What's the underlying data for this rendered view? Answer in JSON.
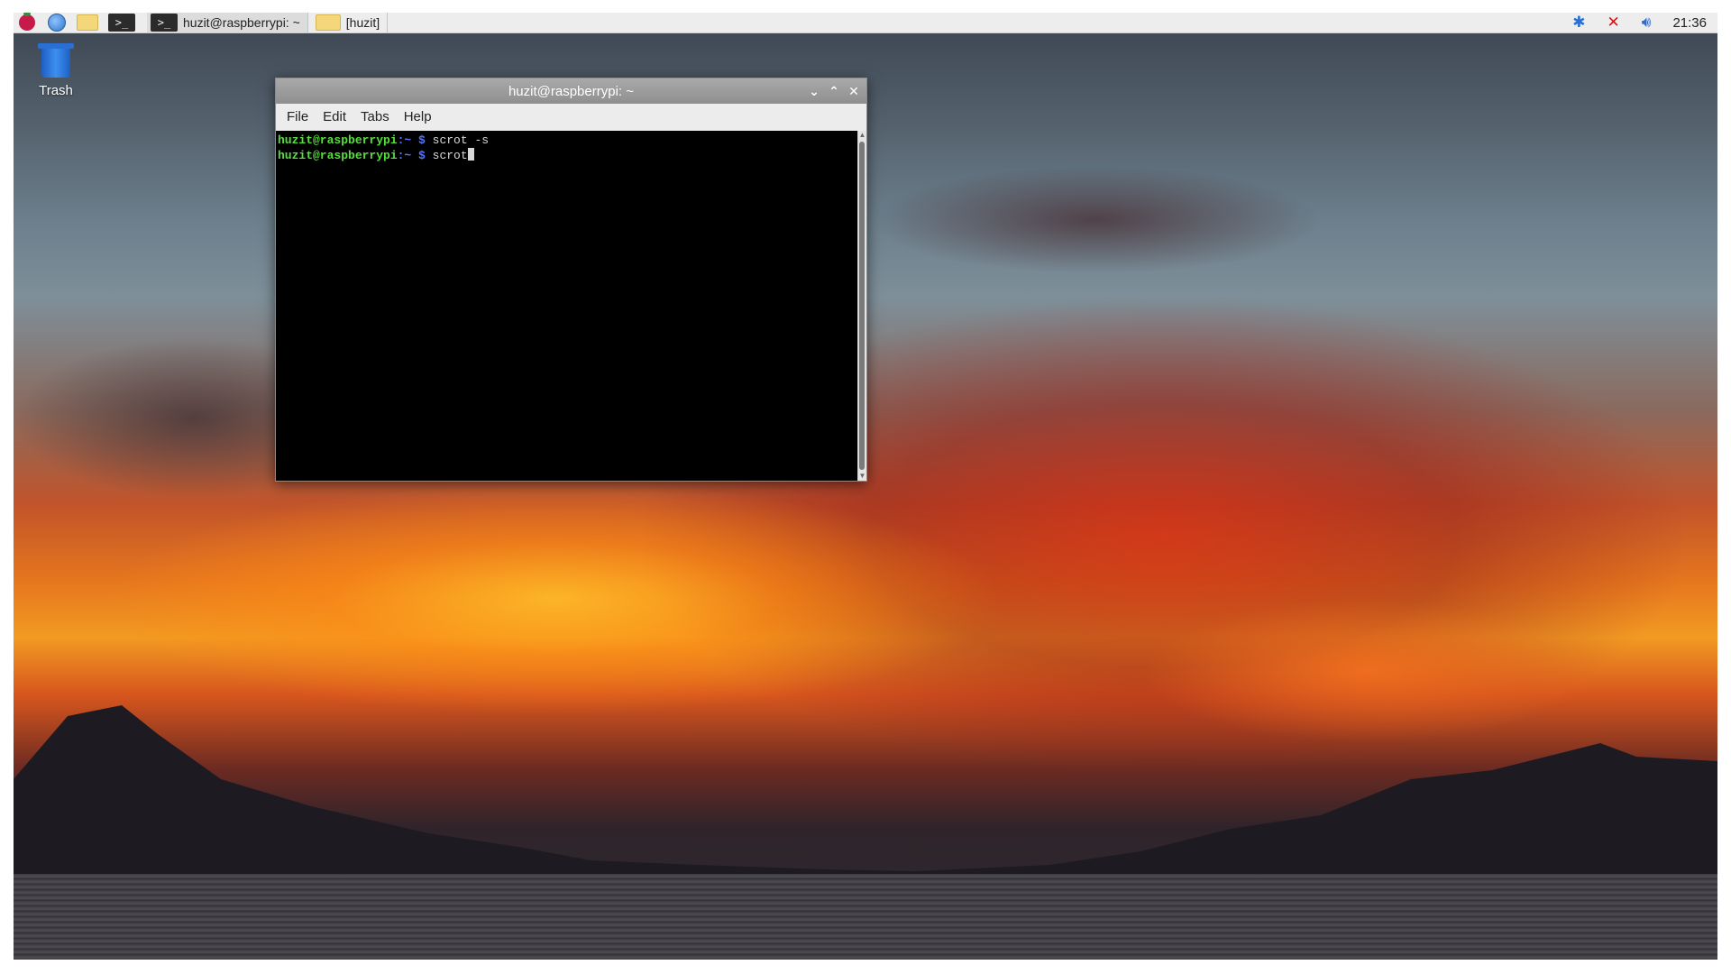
{
  "taskbar": {
    "tasks": [
      {
        "label": "huzit@raspberrypi: ~",
        "icon": "terminal-icon",
        "active": true
      },
      {
        "label": "[huzit]",
        "icon": "folder-icon",
        "active": false
      }
    ],
    "launcher_terminal_glyph": ">_",
    "task_terminal_glyph": ">_",
    "clock": "21:36"
  },
  "desktop": {
    "icons": [
      {
        "label": "Trash",
        "icon": "trash-icon"
      }
    ]
  },
  "terminal": {
    "title": "huzit@raspberrypi: ~",
    "menu": [
      "File",
      "Edit",
      "Tabs",
      "Help"
    ],
    "lines": [
      {
        "user": "huzit@raspberrypi",
        "path": ":~ $ ",
        "cmd": "scrot -s"
      },
      {
        "user": "huzit@raspberrypi",
        "path": ":~ $ ",
        "cmd": "scrot"
      }
    ]
  },
  "colors": {
    "prompt_user": "#55e03a",
    "prompt_path": "#5577ff",
    "terminal_bg": "#000000",
    "taskbar_bg": "#ededed"
  }
}
